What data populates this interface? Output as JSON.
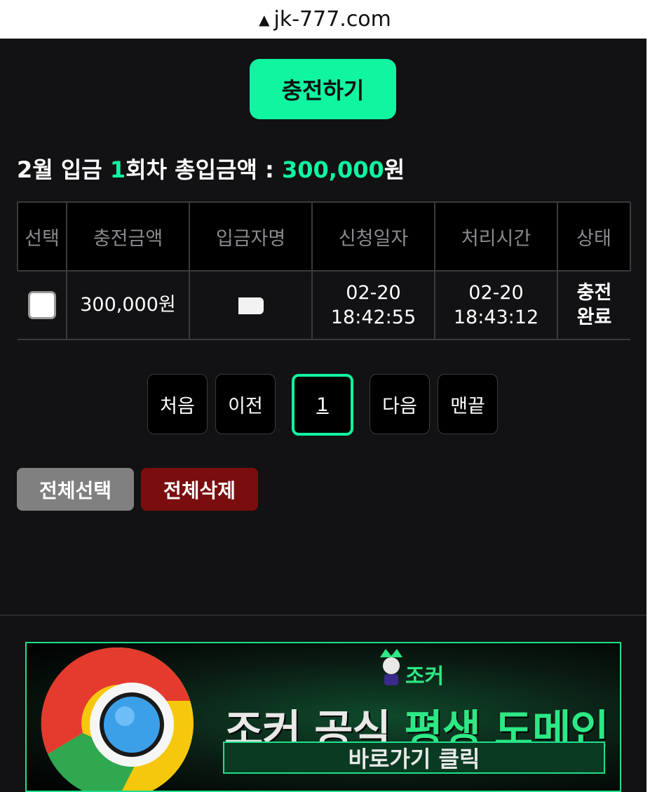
{
  "browser": {
    "url": "jk-777.com",
    "warning_icon": "warning-triangle-icon"
  },
  "charge_button_label": "충전하기",
  "summary": {
    "prefix": "2월 입금 ",
    "count": "1",
    "middle": "회차 총입금액 : ",
    "amount": "300,000",
    "suffix": "원"
  },
  "table": {
    "headers": [
      "선택",
      "충전금액",
      "입금자명",
      "신청일자",
      "처리시간",
      "상태"
    ],
    "rows": [
      {
        "amount": "300,000원",
        "depositor": "",
        "request_date": "02-20",
        "request_time": "18:42:55",
        "process_date": "02-20",
        "process_time": "18:43:12",
        "status_line1": "충전",
        "status_line2": "완료"
      }
    ]
  },
  "pagination": {
    "first": "처음",
    "prev": "이전",
    "current": "1",
    "next": "다음",
    "last": "맨끝"
  },
  "actions": {
    "select_all": "전체선택",
    "delete_all": "전체삭제"
  },
  "banner": {
    "mascot_label": "조커",
    "title_white": "조커 공식 ",
    "title_green": "평생 도메인",
    "cta": "바로가기 클릭"
  },
  "colors": {
    "accent": "#10f5a0",
    "background": "#121214",
    "delete": "#7a0e0e",
    "select": "#808080"
  }
}
